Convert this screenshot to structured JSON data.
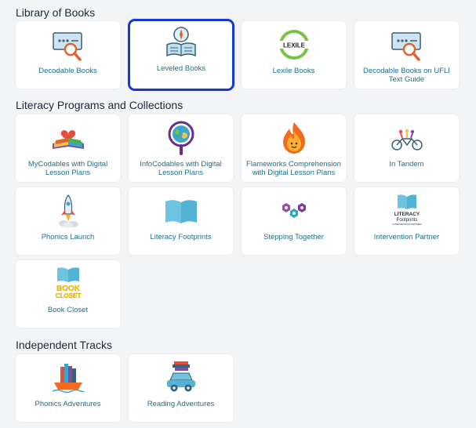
{
  "sections": {
    "library": {
      "title": "Library of Books",
      "cards": [
        {
          "label": "Decodable Books",
          "icon": "book-search-icon"
        },
        {
          "label": "Leveled Books",
          "icon": "compass-book-icon"
        },
        {
          "label": "Lexile Books",
          "icon": "lexile-logo-icon",
          "logo_text": "LEXILE"
        },
        {
          "label": "Decodable Books on UFLI Text Guide",
          "icon": "book-search-icon"
        }
      ]
    },
    "literacy": {
      "title": "Literacy Programs and Collections",
      "cards": [
        {
          "label": "MyCodables with Digital Lesson Plans",
          "icon": "heart-book-icon"
        },
        {
          "label": "InfoCodables with Digital Lesson Plans",
          "icon": "globe-magnifier-icon"
        },
        {
          "label": "Flameworks Comprehension with Digital Lesson Plans",
          "icon": "flame-face-icon"
        },
        {
          "label": "In Tandem",
          "icon": "tandem-bike-icon"
        },
        {
          "label": "Phonics Launch",
          "icon": "rocket-icon"
        },
        {
          "label": "Literacy Footprints",
          "icon": "open-book-icon"
        },
        {
          "label": "Stepping Together",
          "icon": "hexagons-icon"
        },
        {
          "label": "Intervention Partner",
          "icon": "literacy-footprints-logo-icon",
          "logo_text": [
            "LITERACY",
            "Footprints",
            "INTERVENTION PARTNER"
          ]
        },
        {
          "label": "Book Closet",
          "icon": "book-closet-logo-icon",
          "logo_text": [
            "BOOK",
            "CLOSET"
          ]
        }
      ]
    },
    "independent": {
      "title": "Independent Tracks",
      "cards": [
        {
          "label": "Phonics Adventures",
          "icon": "book-boat-icon"
        },
        {
          "label": "Reading Adventures",
          "icon": "book-car-icon"
        }
      ]
    }
  },
  "colors": {
    "page_background": "#f3f4f6",
    "card_background": "#ffffff",
    "label_text": "#1f6f8c",
    "selected_border": "#1238d6",
    "heading_text": "#1f2937"
  }
}
